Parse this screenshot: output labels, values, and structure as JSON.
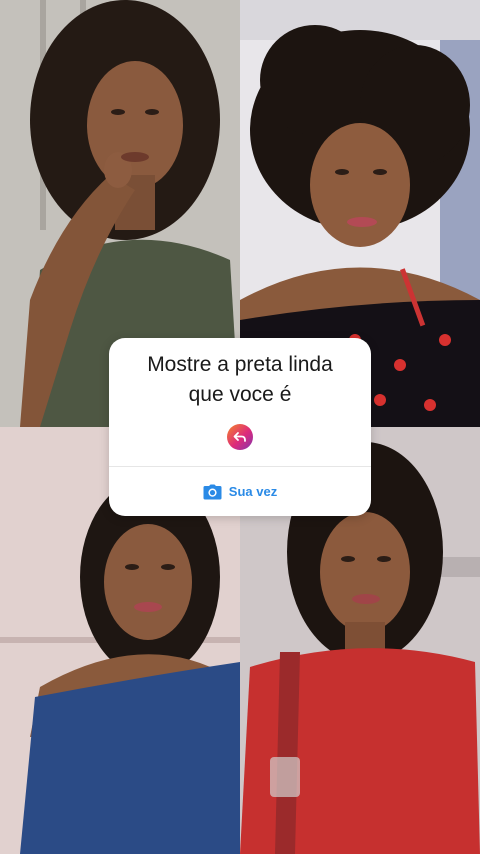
{
  "prompt_card": {
    "line1": "Mostre a preta linda",
    "line2": "que voce é",
    "reply_icon": "reply-arrow-icon",
    "action_label": "Sua vez",
    "action_icon": "camera-icon"
  },
  "colors": {
    "action_blue": "#2a8ae6",
    "gradient_start": "#f58529",
    "gradient_mid": "#dd2a7b",
    "gradient_end": "#8134af"
  },
  "photos": [
    {
      "position": "top-left",
      "outfit": "olive green top"
    },
    {
      "position": "top-right",
      "outfit": "black top with red hearts"
    },
    {
      "position": "bottom-left",
      "outfit": "blue off-shoulder top"
    },
    {
      "position": "bottom-right",
      "outfit": "red dress with bag strap"
    }
  ]
}
